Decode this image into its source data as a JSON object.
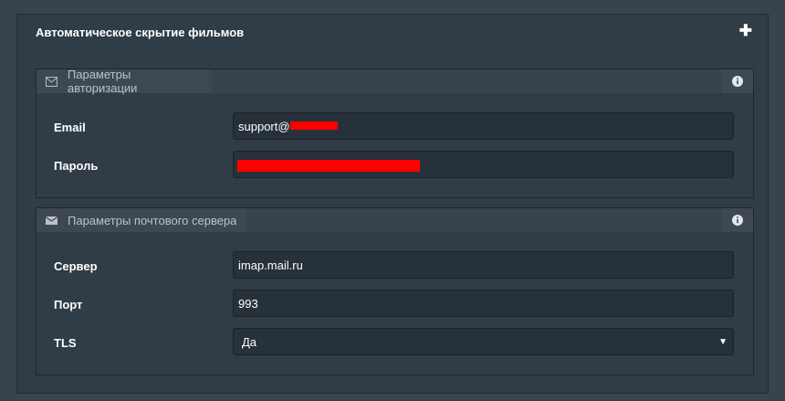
{
  "panel": {
    "title": "Автоматическое скрытие фильмов",
    "expand_icon": "plus-icon"
  },
  "auth_section": {
    "title": "Параметры авторизации",
    "icon": "envelope-outline-icon",
    "info_icon": "info-icon",
    "fields": {
      "email_label": "Email",
      "email_value": "support@",
      "password_label": "Пароль"
    }
  },
  "mail_section": {
    "title": "Параметры почтового сервера",
    "icon": "envelope-icon",
    "info_icon": "info-icon",
    "fields": {
      "server_label": "Сервер",
      "server_value": "imap.mail.ru",
      "port_label": "Порт",
      "port_value": "993",
      "tls_label": "TLS",
      "tls_value": "Да"
    }
  },
  "colors": {
    "background": "#37434d",
    "panel": "#303c46",
    "input": "#27313a",
    "redaction": "#ff0000"
  }
}
